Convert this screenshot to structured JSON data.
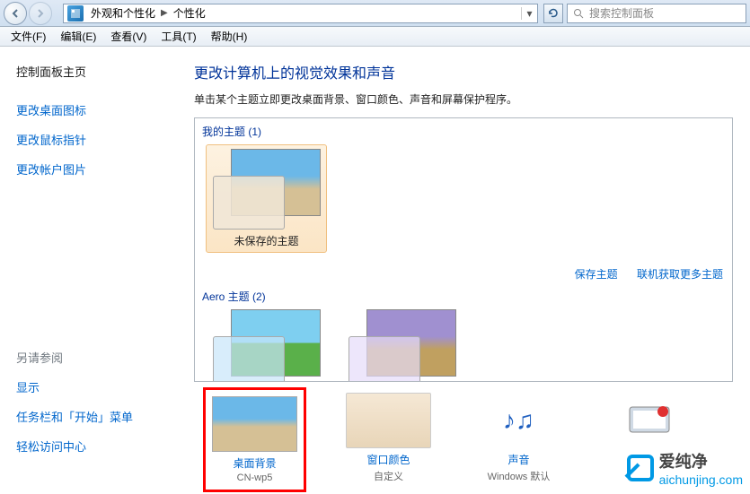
{
  "titlebar": {
    "breadcrumb": {
      "seg1": "外观和个性化",
      "seg2": "个性化"
    },
    "search_placeholder": "搜索控制面板"
  },
  "menu": {
    "file": "文件(F)",
    "edit": "编辑(E)",
    "view": "查看(V)",
    "tools": "工具(T)",
    "help": "帮助(H)"
  },
  "sidebar": {
    "home": "控制面板主页",
    "desktop_icons": "更改桌面图标",
    "mouse_pointers": "更改鼠标指针",
    "account_picture": "更改帐户图片",
    "see_also": "另请参阅",
    "display": "显示",
    "taskbar": "任务栏和「开始」菜单",
    "ease": "轻松访问中心"
  },
  "content": {
    "heading": "更改计算机上的视觉效果和声音",
    "description": "单击某个主题立即更改桌面背景、窗口颜色、声音和屏幕保护程序。",
    "my_themes_label": "我的主题 (1)",
    "unsaved_theme": "未保存的主题",
    "save_theme": "保存主题",
    "get_more_themes": "联机获取更多主题",
    "aero_themes_label": "Aero 主题 (2)"
  },
  "bottom": {
    "bg": {
      "label": "桌面背景",
      "sub": "CN-wp5"
    },
    "color": {
      "label": "窗口颜色",
      "sub": "自定义"
    },
    "sound": {
      "label": "声音",
      "sub": "Windows 默认"
    }
  },
  "watermark": {
    "brand": "爱纯净",
    "url": "aichunjing.com"
  }
}
